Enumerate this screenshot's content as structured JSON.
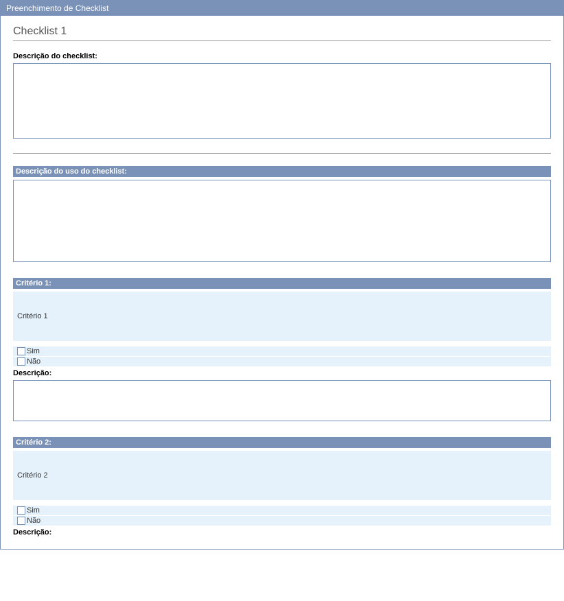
{
  "window": {
    "title": "Preenchimento de Checklist"
  },
  "page": {
    "title": "Checklist 1"
  },
  "description_label": "Descrição do checklist:",
  "description_value": "",
  "usage_section_header": "Descrição do uso do checklist:",
  "usage_value": "",
  "criteria": [
    {
      "header": "Critério 1:",
      "text": "Critério 1",
      "yes_label": "Sim",
      "no_label": "Não",
      "desc_label": "Descrição:",
      "desc_value": ""
    },
    {
      "header": "Critério 2:",
      "text": "Critério 2",
      "yes_label": "Sim",
      "no_label": "Não",
      "desc_label": "Descrição:",
      "desc_value": ""
    }
  ]
}
